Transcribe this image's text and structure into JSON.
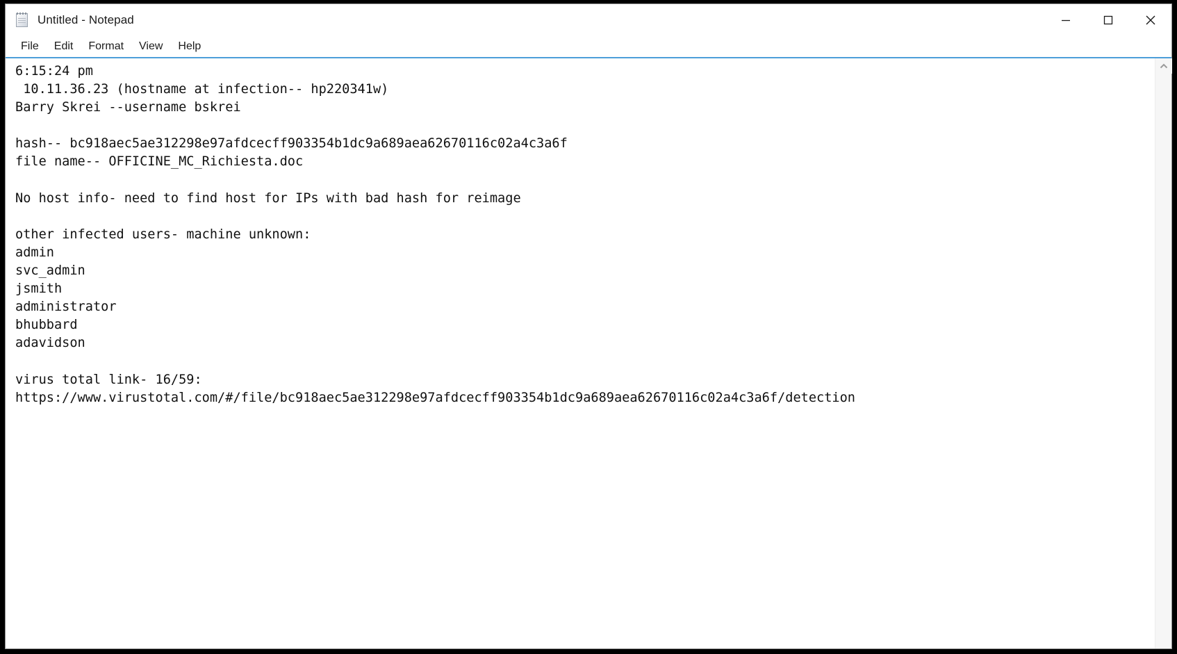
{
  "window": {
    "title": "Untitled - Notepad",
    "icon": "notepad-icon",
    "controls": {
      "minimize": "Minimize",
      "maximize": "Maximize",
      "close": "Close"
    },
    "accent_color": "#4c9ed9",
    "background_color": "#ffffff",
    "desktop_color": "#000000"
  },
  "menu": {
    "items": [
      {
        "label": "File"
      },
      {
        "label": "Edit"
      },
      {
        "label": "Format"
      },
      {
        "label": "View"
      },
      {
        "label": "Help"
      }
    ]
  },
  "document": {
    "text": "6:15:24 pm\n 10.11.36.23 (hostname at infection-- hp220341w)\nBarry Skrei --username bskrei\n\nhash-- bc918aec5ae312298e97afdcecff903354b1dc9a689aea62670116c02a4c3a6f\nfile name-- OFFICINE_MC_Richiesta.doc\n\nNo host info- need to find host for IPs with bad hash for reimage\n\nother infected users- machine unknown:\nadmin\nsvc_admin\njsmith\nadministrator\nbhubbard\nadavidson\n\nvirus total link- 16/59:\nhttps://www.virustotal.com/#/file/bc918aec5ae312298e97afdcecff903354b1dc9a689aea62670116c02a4c3a6f/detection",
    "lines": [
      "6:15:24 pm",
      " 10.11.36.23 (hostname at infection-- hp220341w)",
      "Barry Skrei --username bskrei",
      "",
      "hash-- bc918aec5ae312298e97afdcecff903354b1dc9a689aea62670116c02a4c3a6f",
      "file name-- OFFICINE_MC_Richiesta.doc",
      "",
      "No host info- need to find host for IPs with bad hash for reimage",
      "",
      "other infected users- machine unknown:",
      "admin",
      "svc_admin",
      "jsmith",
      "administrator",
      "bhubbard",
      "adavidson",
      "",
      "virus total link- 16/59:",
      "https://www.virustotal.com/#/file/bc918aec5ae312298e97afdcecff903354b1dc9a689aea62670116c02a4c3a6f/detection"
    ],
    "fields": {
      "timestamp": "6:15:24 pm",
      "ip_address": "10.11.36.23",
      "hostname_at_infection": "hp220341w",
      "user_full_name": "Barry Skrei",
      "username": "bskrei",
      "hash": "bc918aec5ae312298e97afdcecff903354b1dc9a689aea62670116c02a4c3a6f",
      "file_name": "OFFICINE_MC_Richiesta.doc",
      "host_note": "No host info- need to find host for IPs with bad hash for reimage",
      "other_infected_users_header": "other infected users- machine unknown:",
      "other_infected_users": [
        "admin",
        "svc_admin",
        "jsmith",
        "administrator",
        "bhubbard",
        "adavidson"
      ],
      "virus_total_label": "virus total link- 16/59:",
      "virus_total_detections": "16/59",
      "virus_total_url": "https://www.virustotal.com/#/file/bc918aec5ae312298e97afdcecff903354b1dc9a689aea62670116c02a4c3a6f/detection"
    }
  },
  "scrollbar": {
    "up_arrow": "scroll-up-arrow"
  }
}
